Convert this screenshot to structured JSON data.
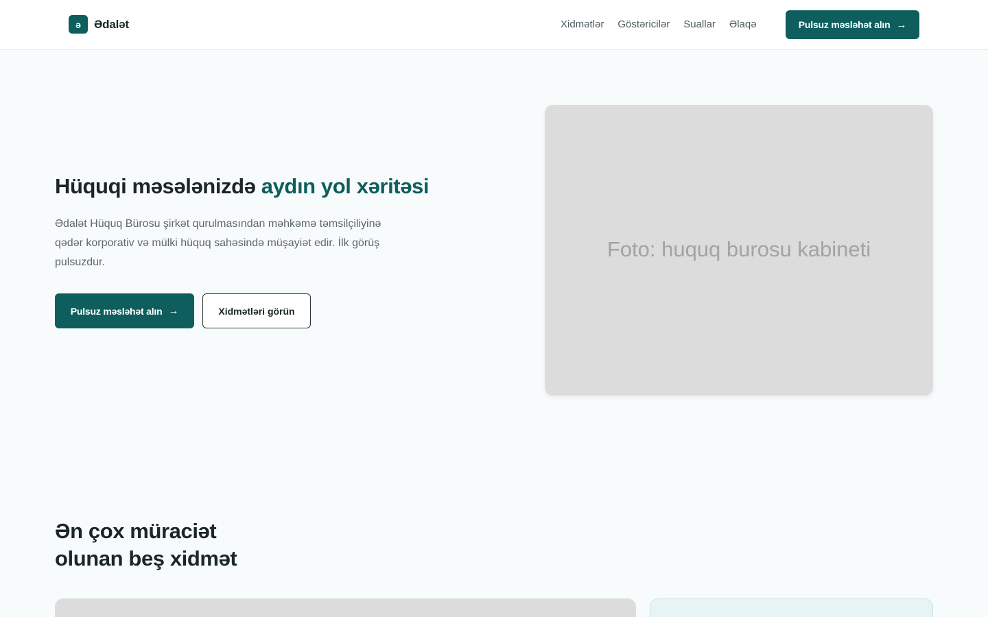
{
  "brand": {
    "mark": "ə",
    "name": "Ədalət"
  },
  "nav": {
    "items": [
      "Xidmətlər",
      "Göstəricilər",
      "Suallar",
      "Əlaqə"
    ],
    "cta_label": "Pulsuz məsləhət alın",
    "cta_arrow": "→"
  },
  "hero": {
    "title_main": "Hüquqi məsələnizdə ",
    "title_accent": "aydın yol xəritəsi",
    "description": "Ədalət Hüquq Bürosu şirkət qurulmasından məhkəmə təmsilçiliyinə qədər korporativ və mülki hüquq sahəsində müşayiət edir. İlk görüş pulsuzdur.",
    "primary_label": "Pulsuz məsləhət alın",
    "primary_arrow": "→",
    "secondary_label": "Xidmətləri görün",
    "photo_caption": "Foto: huquq burosu kabineti"
  },
  "services": {
    "title": "Ən çox müraciət olunan beş xidmət"
  },
  "colors": {
    "primary": "#0d5e5d",
    "background": "#f8fbfc",
    "text": "#1b2626",
    "muted": "#5c6869",
    "placeholder": "#dcdcdc"
  }
}
